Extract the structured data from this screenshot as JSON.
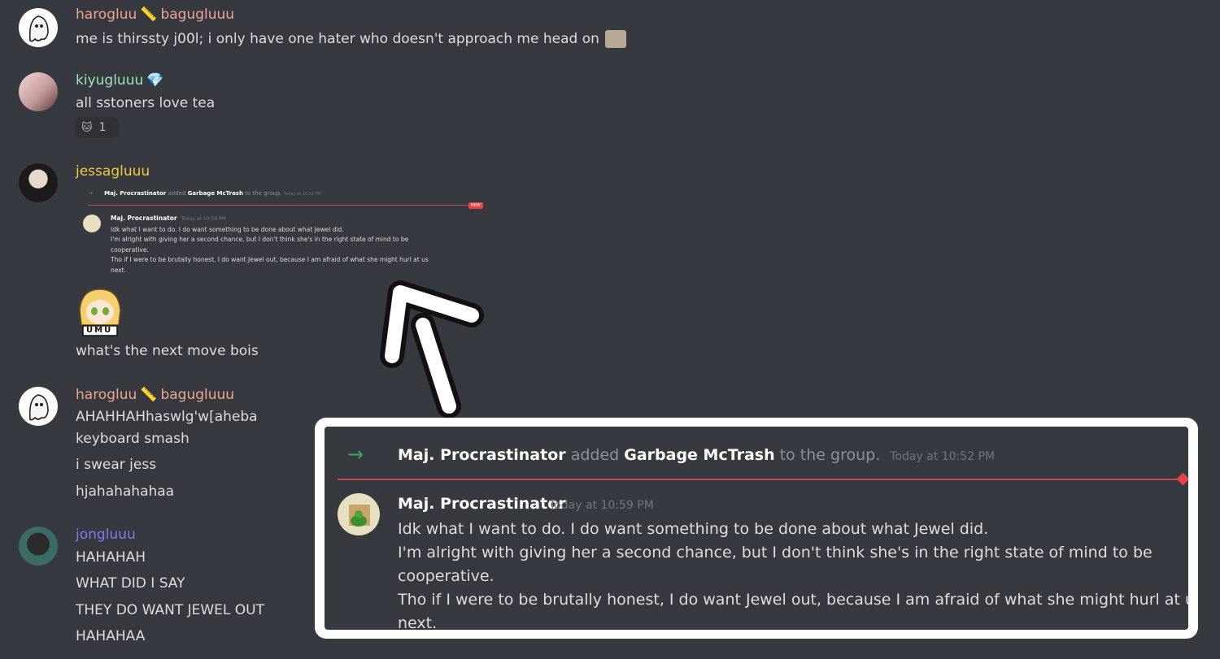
{
  "messages": [
    {
      "user": "harogluu",
      "sep_emoji": "📏",
      "user2": "bagugluuu",
      "lines": [
        "me is thirssty j00l; i only have one hater who doesn't approach me head on"
      ]
    },
    {
      "user": "kiyugluuu",
      "badge_emoji": "💎",
      "lines": [
        "all sstoners love tea"
      ],
      "reaction": {
        "emoji": "🐱",
        "count": "1"
      }
    },
    {
      "user": "jessagluuu",
      "lines": [
        "what's the next move bois"
      ],
      "sticker_label": "UMU"
    },
    {
      "user": "harogluu",
      "sep_emoji": "📏",
      "user2": "bagugluuu",
      "lines": [
        "AHAHHAHhaswlg'w[aheba",
        "keyboard smash",
        "i swear jess",
        "hjahahahahaa"
      ]
    },
    {
      "user": "jongluuu",
      "lines": [
        "HAHAHAH",
        "WHAT DID I SAY",
        "THEY DO WANT JEWEL OUT",
        "HAHAHAA"
      ]
    }
  ],
  "embed": {
    "system": {
      "actor": "Maj. Procrastinator",
      "verb": "added",
      "target": "Garbage McTrash",
      "suffix": "to the group.",
      "time": "Today at 10:52 PM"
    },
    "new_label": "NEW",
    "author": "Maj. Procrastinator",
    "time": "Today at 10:59 PM",
    "lines": [
      "Idk what I want to do. I do want something to be done about what Jewel did.",
      "I'm alright with giving her a second chance, but I don't think she's in the right state of mind to be",
      "cooperative.",
      "Tho if I were to be brutally honest, I do want Jewel out, because I am afraid of what she might hurl at us",
      "next."
    ]
  },
  "colors": {
    "background": "#36393f",
    "harogluu": "#f0a58d",
    "kiyugluuu": "#9fe3b5",
    "jessagluuu": "#f5c842",
    "jongluuu": "#7b7cf5",
    "accent_red": "#ed4245",
    "arrow_green": "#3ba55d"
  }
}
